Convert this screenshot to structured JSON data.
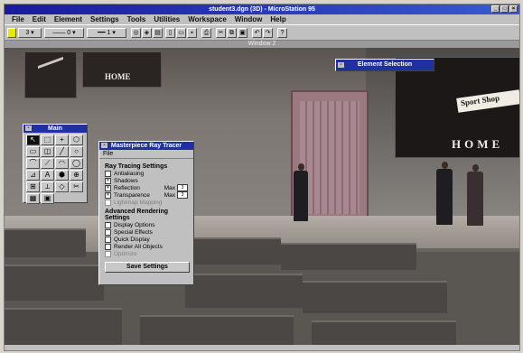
{
  "window": {
    "title": "student3.dgn (3D) - MicroStation 95",
    "view_title": "Window 2"
  },
  "menu": [
    "File",
    "Edit",
    "Element",
    "Settings",
    "Tools",
    "Utilities",
    "Workspace",
    "Window",
    "Help"
  ],
  "toolbar": {
    "level_value": "3",
    "weight_value": "0",
    "color_value": "1"
  },
  "scene": {
    "banner_left_text": "HOME",
    "banner_right_line1": "Sport Shop",
    "banner_right_line2": "HOME"
  },
  "main_palette": {
    "title": "Main",
    "tools": [
      "↖",
      "⬚",
      "+",
      "⬡",
      "▭",
      "◫",
      "╱",
      "○",
      "⌒",
      "⟋",
      "◠",
      "◯",
      "⊿",
      "A",
      "⬢",
      "⊕",
      "⊞",
      "⟂",
      "◇",
      "✂",
      "▦",
      "▣"
    ]
  },
  "element_selection": {
    "title": "Element Selection"
  },
  "raytrace_dialog": {
    "title": "Masterpiece Ray Tracer",
    "file_menu": "File",
    "section1": "Ray Tracing Settings",
    "antialiasing": "Antialiasing",
    "shadows": "Shadows",
    "reflection": "Reflection",
    "transparence": "Transparence",
    "max_label": "Max",
    "reflection_max": "3",
    "transparence_max": "3",
    "light_map": "Lightmap Mapping",
    "section2": "Advanced Rendering Settings",
    "display_options": "Display Options",
    "special_effects": "Special Effects",
    "quick_display": "Quick Display",
    "render_all_objects": "Render All Objects",
    "optimize": "Optimize",
    "save_button": "Save Settings"
  }
}
